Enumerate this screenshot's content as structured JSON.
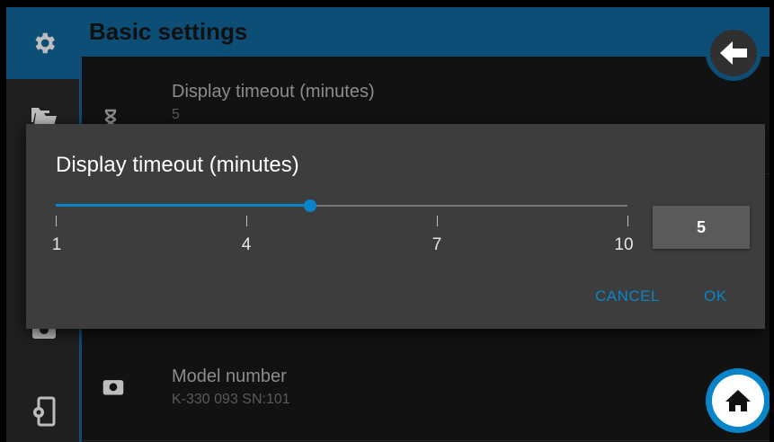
{
  "header": {
    "title": "Basic settings"
  },
  "sidebar": {
    "icons": [
      "gear-icon",
      "folders-icon",
      "camera-icon",
      "settings-exit-icon"
    ]
  },
  "list": [
    {
      "title": "Display timeout (minutes)",
      "value": "5",
      "icon": "hourglass-icon"
    },
    {
      "title": "Model number",
      "value": "K-330 093 SN:101",
      "icon": "camera-icon"
    }
  ],
  "dialog": {
    "title": "Display timeout (minutes)",
    "slider": {
      "min": 1,
      "max": 10,
      "value": 5
    },
    "ticks": [
      "1",
      "4",
      "7",
      "10"
    ],
    "value": "5",
    "cancel": "CANCEL",
    "ok": "OK"
  },
  "colors": {
    "accent": "#0a84c8",
    "header": "#0c4e76",
    "dialog": "#3d3d3d"
  }
}
